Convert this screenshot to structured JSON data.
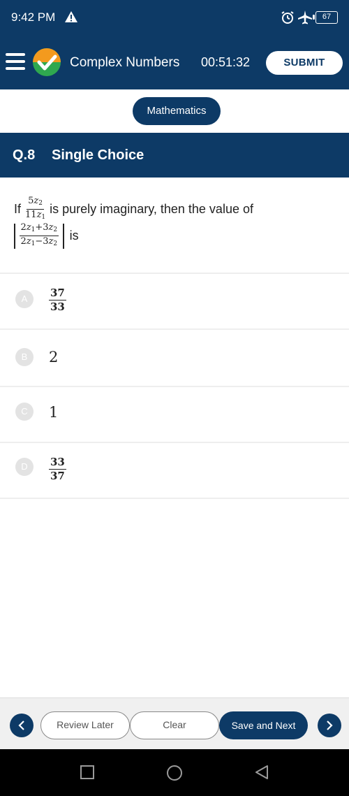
{
  "status_bar": {
    "time": "9:42 PM",
    "battery": "67"
  },
  "header": {
    "title": "Complex Numbers",
    "timer": "00:51:32",
    "submit_label": "SUBMIT"
  },
  "subject": "Mathematics",
  "question": {
    "number": "Q.8",
    "type": "Single Choice",
    "text_prefix": "If",
    "text_middle": "is purely imaginary, then the value of",
    "text_suffix": "is",
    "fraction1_numerator": "5z2",
    "fraction1_denominator": "11z1",
    "fraction2_numerator": "2z1+3z2",
    "fraction2_denominator": "2z1−3z2"
  },
  "options": [
    {
      "letter": "A",
      "numerator": "37",
      "denominator": "33"
    },
    {
      "letter": "B",
      "value": "2"
    },
    {
      "letter": "C",
      "value": "1"
    },
    {
      "letter": "D",
      "numerator": "33",
      "denominator": "37"
    }
  ],
  "footer": {
    "review_later_label": "Review Later",
    "clear_label": "Clear",
    "save_next_label": "Save and Next"
  },
  "colors": {
    "primary": "#0d3a66",
    "option_circle": "#e3e3e3"
  },
  "icons": [
    "warning-icon",
    "alarm-icon",
    "airplane-icon",
    "battery-icon",
    "menu-icon",
    "logo-check-icon",
    "chevron-left-icon",
    "chevron-right-icon",
    "square-nav-icon",
    "circle-nav-icon",
    "triangle-nav-icon"
  ]
}
